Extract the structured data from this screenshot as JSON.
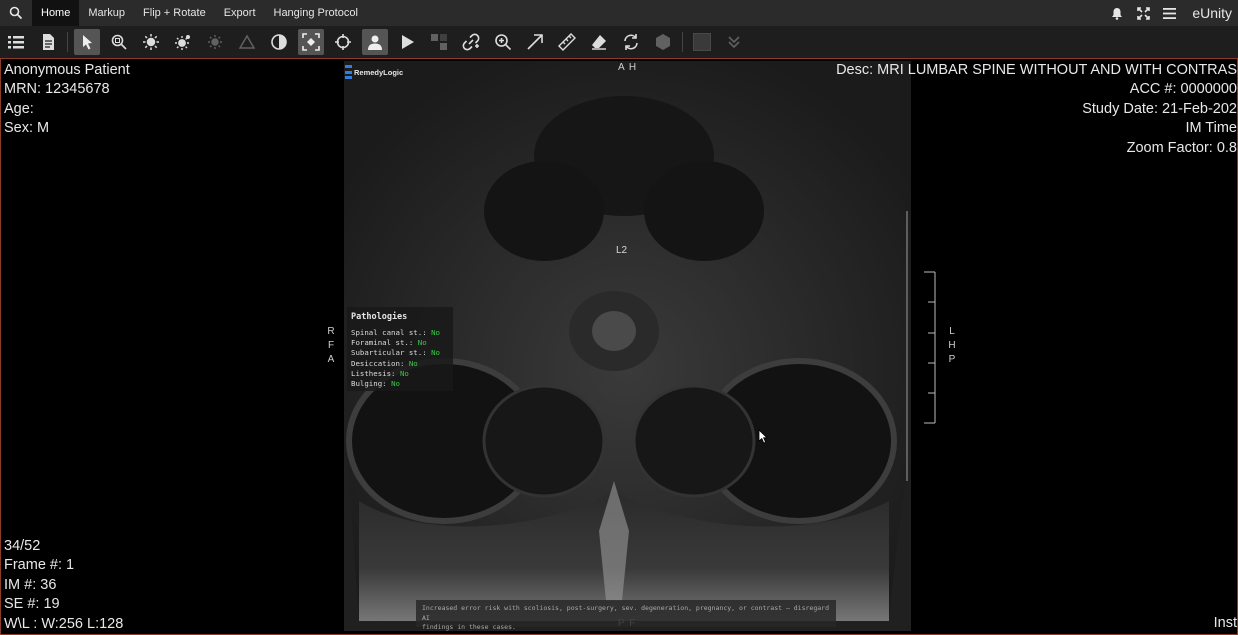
{
  "menubar": {
    "tabs": [
      {
        "label": "Home",
        "active": true
      },
      {
        "label": "Markup",
        "active": false
      },
      {
        "label": "Flip + Rotate",
        "active": false
      },
      {
        "label": "Export",
        "active": false
      },
      {
        "label": "Hanging Protocol",
        "active": false
      }
    ],
    "brand": "eUnity",
    "icons": [
      "search-icon",
      "bell-icon",
      "fullscreen-icon",
      "hamburger-menu-icon"
    ]
  },
  "toolbar": {
    "tools": [
      "study-list-icon",
      "report-icon",
      "pointer-icon",
      "zoom-region-icon",
      "brightness-icon",
      "auto-window-level-icon",
      "window-level-preset-icon",
      "triangle-icon",
      "invert-icon",
      "fit-to-window-icon",
      "crosshair-icon",
      "avatar-icon",
      "cine-play-icon",
      "layout-icon",
      "link-icon",
      "magnify-icon",
      "arrow-icon",
      "ruler-icon",
      "eraser-icon",
      "sync-icon",
      "3d-cube-icon",
      "color-swatch-icon",
      "chevrons-down-icon"
    ]
  },
  "overlay": {
    "top_left": {
      "patient_name": "Anonymous Patient",
      "mrn": "MRN: 12345678",
      "age": "Age:",
      "sex": "Sex: M"
    },
    "top_right": {
      "desc": "Desc: MRI LUMBAR SPINE WITHOUT AND WITH CONTRAS",
      "acc": "ACC #: 0000000",
      "study_date": "Study Date: 21-Feb-202",
      "im_time": "IM Time",
      "zoom_factor": "Zoom Factor: 0.8"
    },
    "bottom_left": {
      "image_index": "34/52",
      "frame": "Frame #: 1",
      "im_number": "IM #: 36",
      "se_number": "SE #: 19",
      "window_level": "W\\L : W:256 L:128"
    },
    "bottom_right": {
      "inst": "Inst"
    }
  },
  "orientation": {
    "top": "A H",
    "bottom": "P F",
    "left": [
      "R",
      "F",
      "A"
    ],
    "right": [
      "L",
      "H",
      "P"
    ]
  },
  "image": {
    "level_label": "L2",
    "brand_logo": "RemedyLogic"
  },
  "pathologies": {
    "title": "Pathologies",
    "rows": [
      {
        "label": "Spinal canal st.:",
        "value": "No"
      },
      {
        "label": "Foraminal st.:",
        "value": "No"
      },
      {
        "label": "Subarticular st.:",
        "value": "No"
      },
      {
        "label": "Desiccation:",
        "value": "No"
      },
      {
        "label": "Listhesis:",
        "value": "No"
      },
      {
        "label": "Bulging:",
        "value": "No"
      }
    ]
  },
  "disclaimer": {
    "line1": "Increased error risk with scoliosis, post-surgery, sev. degeneration, pregnancy, or contrast – disregard AI",
    "line2": "findings in these cases."
  },
  "colors": {
    "menubar_bg": "#2b2b2b",
    "toolbar_bg": "#1e1e1e",
    "viewport_border": "#8a3b2a",
    "pathology_value": "#38c948",
    "logo_blue": "#2f7de1"
  }
}
